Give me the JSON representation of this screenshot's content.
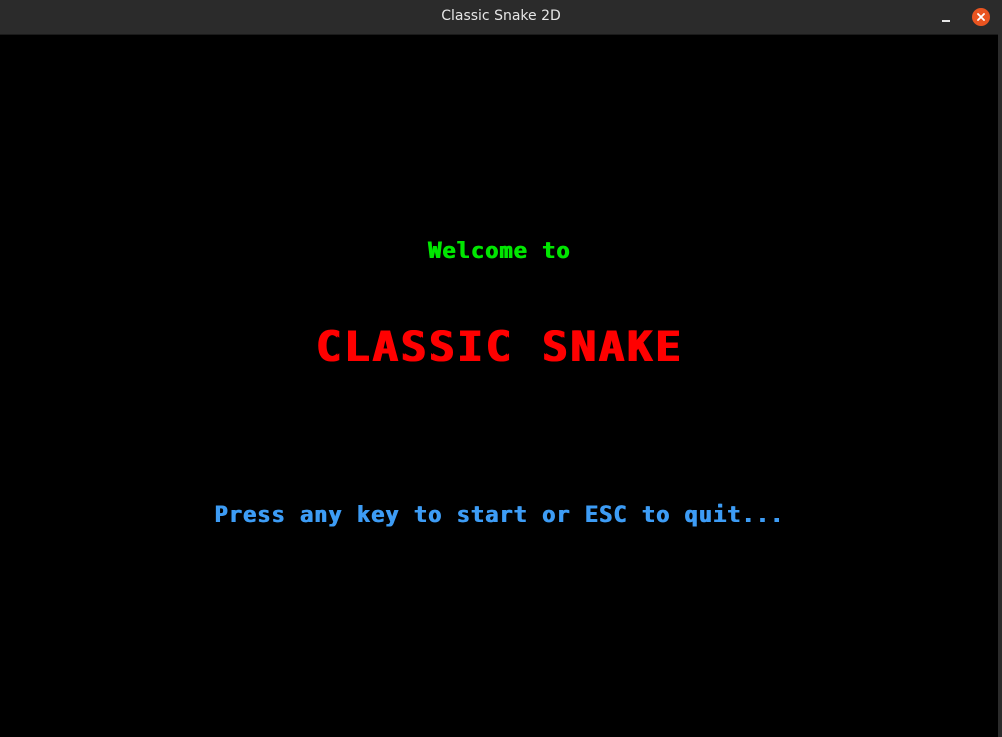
{
  "window": {
    "title": "Classic Snake 2D"
  },
  "screen": {
    "welcome": "Welcome to",
    "title": "CLASSIC SNAKE",
    "prompt": "Press any key to start or ESC to quit..."
  },
  "colors": {
    "welcome": "#00e600",
    "title": "#ff0000",
    "prompt": "#3d9cf5",
    "background": "#000000",
    "titlebar": "#2b2b2b",
    "close_button": "#e95420"
  },
  "icons": {
    "minimize": "minimize-icon",
    "close": "close-icon"
  }
}
